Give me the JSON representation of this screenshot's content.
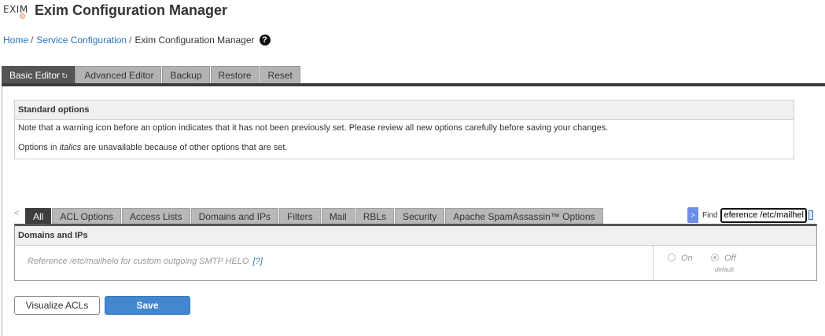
{
  "header": {
    "logo_text": "EXIM",
    "title": "Exim Configuration Manager"
  },
  "breadcrumb": {
    "home": "Home",
    "service": "Service Configuration",
    "current": "Exim Configuration Manager",
    "separator": "/",
    "help_glyph": "?"
  },
  "main_tabs": [
    {
      "label": "Basic Editor",
      "active": true
    },
    {
      "label": "Advanced Editor",
      "active": false
    },
    {
      "label": "Backup",
      "active": false
    },
    {
      "label": "Restore",
      "active": false
    },
    {
      "label": "Reset",
      "active": false
    }
  ],
  "standard_options": {
    "title": "Standard options",
    "note": "Note that a warning icon before an option indicates that it has not been previously set. Please review all new options carefully before saving your changes.",
    "italics_prefix": "Options in ",
    "italics_word": "italics",
    "italics_suffix": " are unavailable because of other options that are set."
  },
  "sub_tabs": [
    {
      "label": "All",
      "active": true
    },
    {
      "label": "ACL Options",
      "active": false
    },
    {
      "label": "Access Lists",
      "active": false
    },
    {
      "label": "Domains and IPs",
      "active": false
    },
    {
      "label": "Filters",
      "active": false
    },
    {
      "label": "Mail",
      "active": false
    },
    {
      "label": "RBLs",
      "active": false
    },
    {
      "label": "Security",
      "active": false
    },
    {
      "label": "Apache SpamAssassin™ Options",
      "active": false
    }
  ],
  "sub_tabs_prev": "<",
  "find": {
    "button": ">",
    "label": "Find",
    "value": "eference /etc/mailhelo"
  },
  "domains_panel": {
    "title": "Domains and IPs",
    "option_label": "Reference /etc/mailhelo for custom outgoing SMTP HELO",
    "help_link": "[?]",
    "radio_on": "On",
    "radio_off": "Off",
    "selected": "Off",
    "default_note": "default"
  },
  "buttons": {
    "visualize": "Visualize ACLs",
    "save": "Save"
  },
  "colors": {
    "link": "#2a73b8",
    "save_button": "#4287cf",
    "active_tab": "#555555",
    "logo_accent": "#f0833a"
  }
}
